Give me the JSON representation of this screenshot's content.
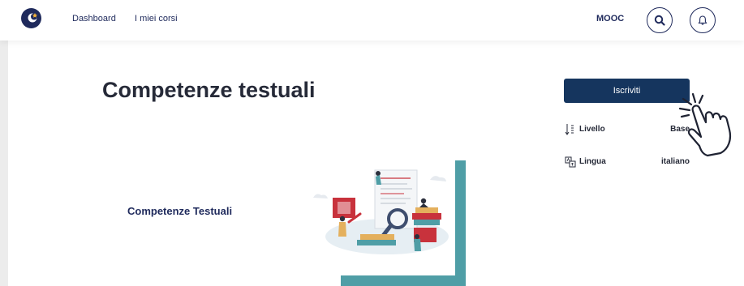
{
  "nav": {
    "logo": "app-logo",
    "links": [
      "Dashboard",
      "I miei corsi"
    ],
    "mooc": "MOOC",
    "search_icon": "search-icon",
    "bell_icon": "bell-icon"
  },
  "course": {
    "title": "Competenze testuali",
    "card_title": "Competenze Testuali",
    "enroll_label": "Iscriviti",
    "info": [
      {
        "icon": "level-icon",
        "label": "Livello",
        "value": "Base"
      },
      {
        "icon": "language-icon",
        "label": "Lingua",
        "value": "italiano"
      }
    ]
  },
  "colors": {
    "primary": "#15355e",
    "text": "#262a38",
    "teal": "#4f9ea6",
    "accent_red": "#c8323c"
  }
}
